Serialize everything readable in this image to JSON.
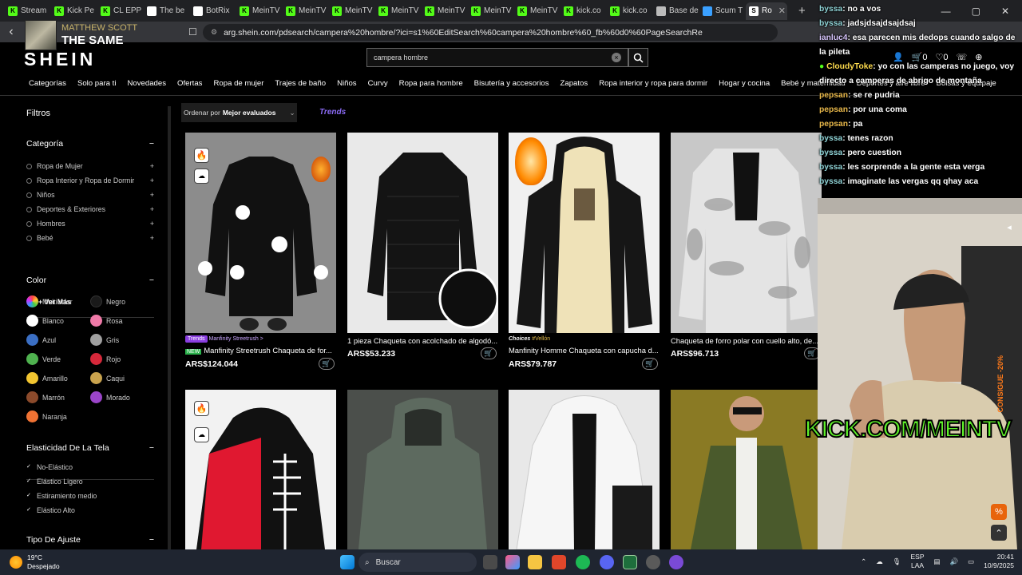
{
  "tabs": [
    {
      "label": "Stream",
      "color": "#53fc18",
      "icon": "kick-icon"
    },
    {
      "label": "Kick Pe",
      "color": "#53fc18",
      "icon": "kick-icon"
    },
    {
      "label": "CL EPP",
      "color": "#53fc18",
      "icon": "kick-icon"
    },
    {
      "label": "The be",
      "color": "#ffffff",
      "icon": "diamond-icon"
    },
    {
      "label": "BotRix",
      "color": "#ffffff",
      "icon": "gear-icon"
    },
    {
      "label": "MeinTV",
      "color": "#53fc18",
      "icon": "kick-icon"
    },
    {
      "label": "MeinTV",
      "color": "#53fc18",
      "icon": "kick-icon"
    },
    {
      "label": "MeinTV",
      "color": "#53fc18",
      "icon": "kick-icon"
    },
    {
      "label": "MeinTV",
      "color": "#53fc18",
      "icon": "kick-icon"
    },
    {
      "label": "MeinTV",
      "color": "#53fc18",
      "icon": "kick-icon"
    },
    {
      "label": "MeinTV",
      "color": "#53fc18",
      "icon": "kick-icon"
    },
    {
      "label": "MeinTV",
      "color": "#53fc18",
      "icon": "kick-icon"
    },
    {
      "label": "kick.co",
      "color": "#53fc18",
      "icon": "kick-icon"
    },
    {
      "label": "kick.co",
      "color": "#53fc18",
      "icon": "kick-icon"
    },
    {
      "label": "Base de",
      "color": "#bbbbbb",
      "icon": "globe-icon"
    },
    {
      "label": "Scum T",
      "color": "#3aa0ff",
      "icon": "globe-icon"
    },
    {
      "label": "Ro",
      "color": "#ffffff",
      "icon": "shein-icon"
    }
  ],
  "active_tab_label": "Rop",
  "address": {
    "url": "arg.shein.com/pdsearch/campera%20hombre/?ici=s1%60EditSearch%60campera%20hombre%60_fb%60d0%60PageSearchResult&search_sourc..."
  },
  "now_playing": {
    "artist": "MATTHEW SCOTT",
    "title": "THE SAME"
  },
  "shein": {
    "logo": "SHEIN",
    "search_value": "campera hombre",
    "cart_count": "0",
    "wishlist_count": "0",
    "categories": [
      "Categorías",
      "Solo para ti",
      "Novedades",
      "Ofertas",
      "Ropa de mujer",
      "Trajes de baño",
      "Niños",
      "Curvy",
      "Ropa para hombre",
      "Bisutería y accesorios",
      "Zapatos",
      "Ropa interior y ropa para dormir",
      "Hogar y cocina",
      "Bebé y maternidad",
      "Deportes y aire libre",
      "Bolsas y equipaje"
    ]
  },
  "sidebar": {
    "title": "Filtros",
    "categoria": {
      "heading": "Categoría",
      "items": [
        "Ropa de Mujer",
        "Ropa Interior y Ropa de Dormir",
        "Niños",
        "Deportes & Exteriores",
        "Hombres",
        "Bebé"
      ],
      "more": "+ Ver Más"
    },
    "color": {
      "heading": "Color",
      "items": [
        {
          "name": "Multicolor",
          "hex": "multi"
        },
        {
          "name": "Negro",
          "hex": "#1a1a1a"
        },
        {
          "name": "Blanco",
          "hex": "#ffffff"
        },
        {
          "name": "Rosa",
          "hex": "#f07aa8"
        },
        {
          "name": "Azul",
          "hex": "#3b6fc4"
        },
        {
          "name": "Gris",
          "hex": "#a0a0a0"
        },
        {
          "name": "Verde",
          "hex": "#4fb24f"
        },
        {
          "name": "Rojo",
          "hex": "#d6283a"
        },
        {
          "name": "Amarillo",
          "hex": "#f2c530"
        },
        {
          "name": "Caqui",
          "hex": "#c9a34e"
        },
        {
          "name": "Marrón",
          "hex": "#8b4a2b"
        },
        {
          "name": "Morado",
          "hex": "#9b45c9"
        },
        {
          "name": "Naranja",
          "hex": "#f07233"
        }
      ]
    },
    "elasticidad": {
      "heading": "Elasticidad De La Tela",
      "items": [
        "No-Elástico",
        "Elástico Ligero",
        "Estiramiento medio",
        "Elástico Alto"
      ]
    },
    "ajuste": {
      "heading": "Tipo De Ajuste"
    }
  },
  "toolbar": {
    "sort_prefix": "Ordenar por",
    "sort_value": "Mejor evaluados",
    "trends": "Trends"
  },
  "products": [
    {
      "title": "Manfinity Streetrush Chaqueta de for...",
      "price": "ARS$124.044",
      "brand": "Trends",
      "store": "Manfinity Streetrush >",
      "new": "NEW"
    },
    {
      "title": "1 pieza Chaqueta con acolchado de algodó...",
      "price": "ARS$53.233"
    },
    {
      "title": "Manfinity Homme Chaqueta con capucha d...",
      "price": "ARS$79.787",
      "brand": "Choices",
      "store": "#Vellón"
    },
    {
      "title": "Chaqueta de forro polar con cuello alto, de...",
      "price": "ARS$96.713"
    }
  ],
  "chat": [
    {
      "user": "byssa",
      "color": "#8fd3d6",
      "text": ": no a vos"
    },
    {
      "user": "byssa",
      "color": "#8fd3d6",
      "text": ": jadsjdsajdsajdsaj"
    },
    {
      "user": "ianluc4",
      "color": "#d9c7ff",
      "text": ": esa parecen mis dedops cuando salgo de la pileta"
    },
    {
      "user": "CloudyToke",
      "color": "#ffdc4d",
      "text": ": yo con las camperas no juego, voy directo a camperas de abrigo de montaña"
    },
    {
      "user": "pepsan",
      "color": "#e8b84a",
      "text": ": se re pudria"
    },
    {
      "user": "pepsan",
      "color": "#e8b84a",
      "text": ": por una coma"
    },
    {
      "user": "pepsan",
      "color": "#e8b84a",
      "text": ": pa"
    },
    {
      "user": "byssa",
      "color": "#8fd3d6",
      "text": ": tenes razon"
    },
    {
      "user": "byssa",
      "color": "#8fd3d6",
      "text": ": pero cuestion"
    },
    {
      "user": "byssa",
      "color": "#8fd3d6",
      "text": ": les sorprende a la gente esta verga"
    },
    {
      "user": "byssa",
      "color": "#8fd3d6",
      "text": ": imaginate las vergas qq qhay aca"
    }
  ],
  "overlay": {
    "kick_url": "KICK.COM/MEINTV",
    "promo": "CONSIGUE -20%"
  },
  "taskbar": {
    "temp": "19°C",
    "weather": "Despejado",
    "search": "Buscar",
    "lang1": "ESP",
    "lang2": "LAA",
    "time": "20:41",
    "date": "10/9/2025"
  }
}
